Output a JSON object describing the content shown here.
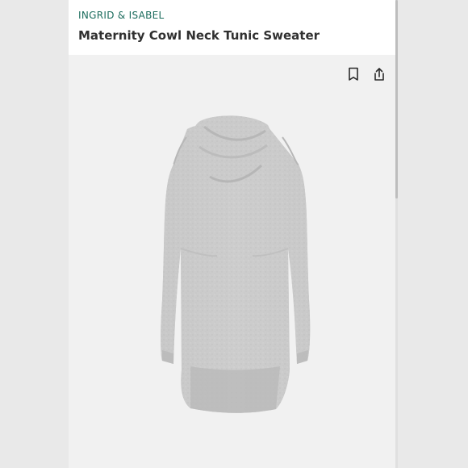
{
  "header": {
    "brand": "INGRID & ISABEL",
    "title": "Maternity Cowl Neck Tunic Sweater"
  },
  "icons": {
    "bookmark": "bookmark-icon",
    "share": "share-icon"
  },
  "colors": {
    "brand": "#1b6c5d",
    "background": "#f1f1f1",
    "sweater": "#c8c8c8"
  }
}
